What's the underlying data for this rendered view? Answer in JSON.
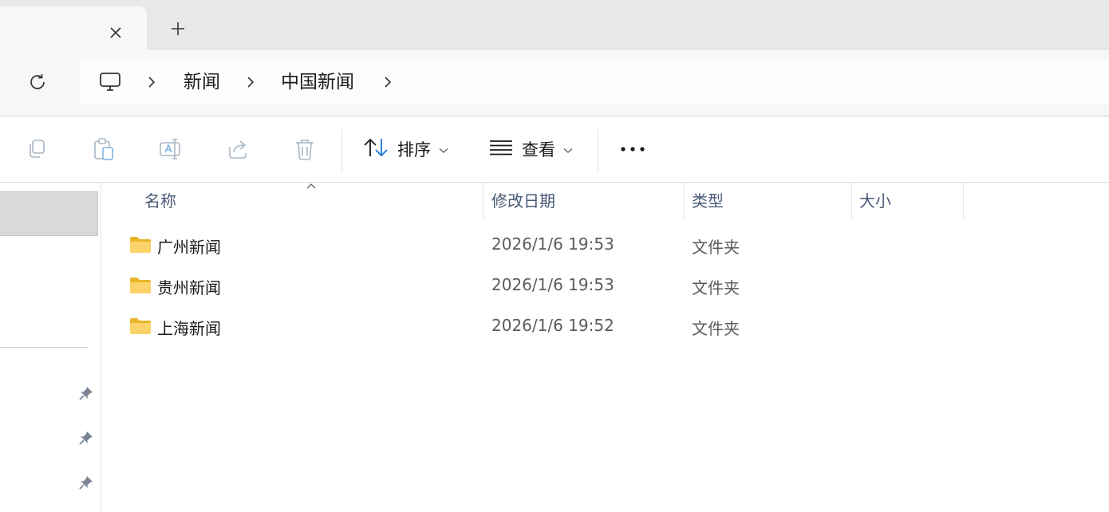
{
  "tabs": {
    "close_icon": "close-icon",
    "new_tab_icon": "plus-icon"
  },
  "address": {
    "refresh_icon": "refresh-icon",
    "root_icon": "computer-icon",
    "crumbs": [
      "新闻",
      "中国新闻"
    ]
  },
  "toolbar": {
    "copy_icon": "copy-icon",
    "paste_icon": "paste-icon",
    "rename_icon": "rename-icon",
    "share_icon": "share-icon",
    "delete_icon": "delete-icon",
    "sort_label": "排序",
    "view_label": "查看",
    "more_icon": "more-icon"
  },
  "columns": {
    "name": "名称",
    "modified": "修改日期",
    "type": "类型",
    "size": "大小"
  },
  "files": [
    {
      "name": "广州新闻",
      "modified": "2026/1/6 19:53",
      "type": "文件夹",
      "size": ""
    },
    {
      "name": "贵州新闻",
      "modified": "2026/1/6 19:53",
      "type": "文件夹",
      "size": ""
    },
    {
      "name": "上海新闻",
      "modified": "2026/1/6 19:52",
      "type": "文件夹",
      "size": ""
    }
  ],
  "colors": {
    "folder": "#f4c430",
    "accent": "#1976d2",
    "header_text": "#4a5a78"
  }
}
